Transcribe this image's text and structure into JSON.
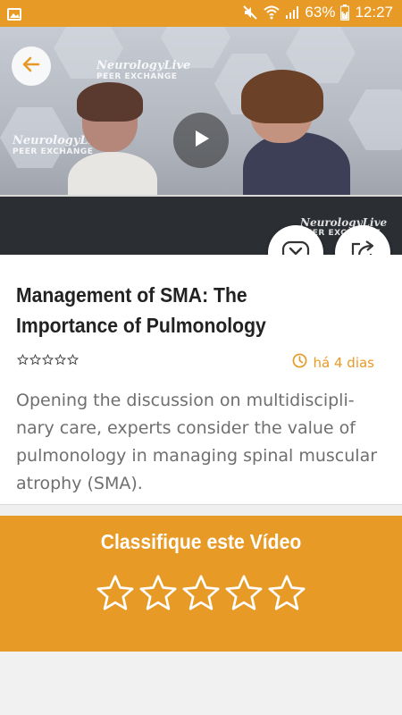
{
  "status_bar": {
    "battery_percent": "63%",
    "time": "12:27",
    "icons": [
      "image-icon",
      "mute-icon",
      "wifi-icon",
      "signal-icon",
      "battery-charging-icon"
    ]
  },
  "video": {
    "brand_name": "NeurologyLive",
    "brand_sub": "PEER EXCHANGE",
    "brand_name_2": "NeurologyLive",
    "brand_sub_2": "PEER EXCHANGE",
    "brand_name_3": "NeurologyLive",
    "brand_sub_3": "PEER EXCHANGE",
    "icons": [
      "back-arrow-icon",
      "play-icon",
      "chevron-down-icon",
      "share-icon"
    ]
  },
  "article": {
    "title": "Management of SMA: The Importance of Pulmonology",
    "time_ago": "há 4 dias",
    "description": "Opening the discussion on multidiscipli-nary care, experts consider the value of pulmonology in managing spinal muscular atrophy (SMA).",
    "rating_stars": 0,
    "max_stars": 5
  },
  "rating_section": {
    "title": "Classifique este Vídeo",
    "selected_stars": 0,
    "max_stars": 5
  },
  "colors": {
    "accent": "#e89a26",
    "text": "#222222",
    "muted": "#6f6f6f"
  }
}
